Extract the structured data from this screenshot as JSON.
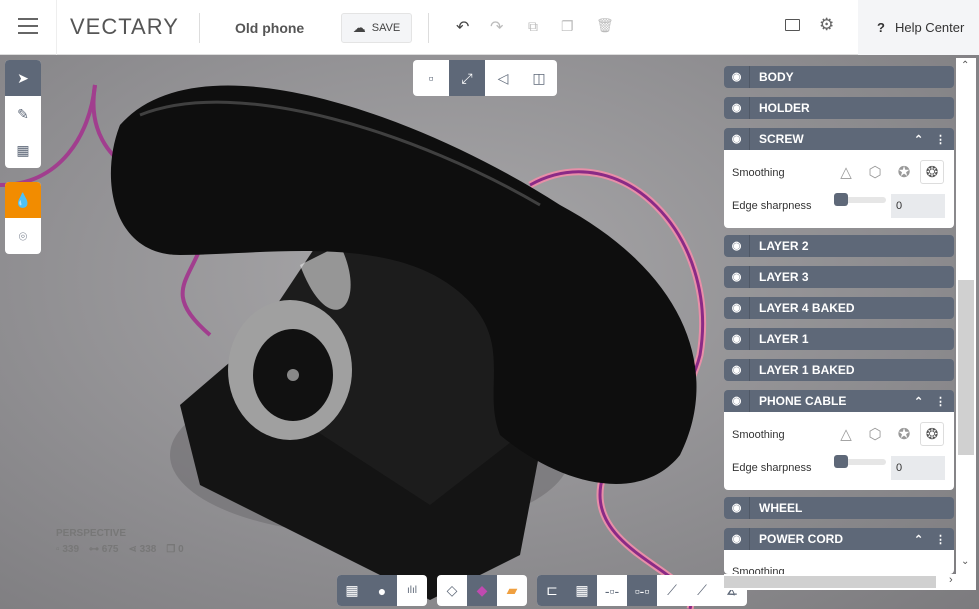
{
  "header": {
    "logo": "VECTARY",
    "project_name": "Old phone",
    "save_label": "SAVE",
    "help_label": "Help Center",
    "help_icon": "?"
  },
  "viewport": {
    "camera": "PERSPECTIVE",
    "stats": {
      "faces": "339",
      "edges": "675",
      "vertices": "338",
      "objects": "0"
    }
  },
  "layers": [
    {
      "name": "BODY"
    },
    {
      "name": "HOLDER"
    },
    {
      "name": "SCREW",
      "expanded": true,
      "smoothing_label": "Smoothing",
      "edge_label": "Edge sharpness",
      "edge_value": "0",
      "edge_fraction": 0
    },
    {
      "name": "LAYER 2"
    },
    {
      "name": "LAYER 3"
    },
    {
      "name": "LAYER 4 BAKED"
    },
    {
      "name": "LAYER 1"
    },
    {
      "name": "LAYER 1 BAKED"
    },
    {
      "name": "PHONE CABLE",
      "expanded": true,
      "smoothing_label": "Smoothing",
      "edge_label": "Edge sharpness",
      "edge_value": "0",
      "edge_fraction": 0
    },
    {
      "name": "WHEEL"
    },
    {
      "name": "POWER CORD",
      "expanded": true,
      "smoothing_label": "Smoothing"
    }
  ],
  "colors": {
    "accent": "#f28c00",
    "panel": "#5e6878"
  }
}
